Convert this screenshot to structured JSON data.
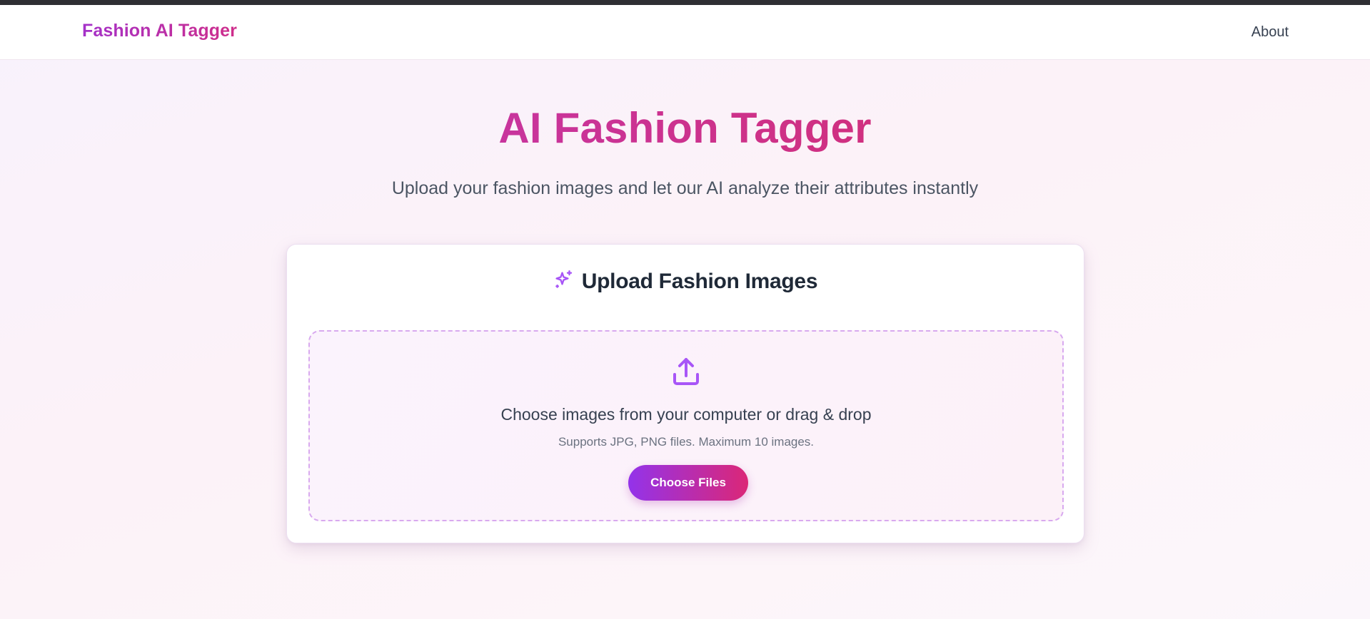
{
  "nav": {
    "brand": "Fashion AI Tagger",
    "links": [
      {
        "label": "About"
      }
    ]
  },
  "hero": {
    "title": "AI Fashion Tagger",
    "subtitle": "Upload your fashion images and let our AI analyze their attributes instantly"
  },
  "upload_card": {
    "title": "Upload Fashion Images",
    "title_icon": "sparkles-icon",
    "dropzone": {
      "icon": "upload-icon",
      "instruction": "Choose images from your computer or drag & drop",
      "hint": "Supports JPG, PNG files. Maximum 10 images.",
      "button_label": "Choose Files"
    }
  },
  "colors": {
    "accent_purple": "#9333ea",
    "accent_pink": "#db2777",
    "title_pink": "#cc3290",
    "icon_purple": "#a855f7",
    "dashed_border": "#d8a9ef"
  }
}
